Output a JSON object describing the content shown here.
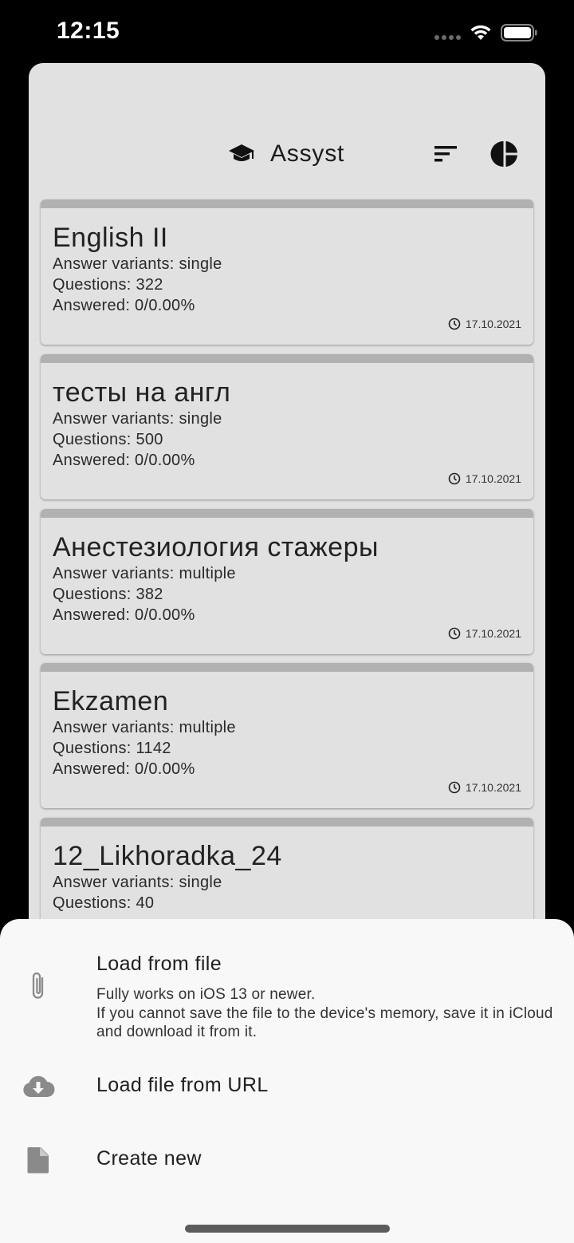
{
  "status_bar": {
    "time": "12:15"
  },
  "app": {
    "title": "Assyst",
    "icons": {
      "logo": "graduation-cap-icon",
      "sort": "sort-icon",
      "stats": "pie-chart-icon"
    }
  },
  "tests": [
    {
      "title": "English II",
      "variants": "Answer variants: single",
      "questions": "Questions: 322",
      "answered": "Answered: 0/0.00%",
      "date": "17.10.2021"
    },
    {
      "title": "тесты на англ",
      "variants": "Answer variants: single",
      "questions": "Questions: 500",
      "answered": "Answered: 0/0.00%",
      "date": "17.10.2021"
    },
    {
      "title": "Анестезиология стажеры",
      "variants": "Answer variants: multiple",
      "questions": "Questions: 382",
      "answered": "Answered: 0/0.00%",
      "date": "17.10.2021"
    },
    {
      "title": "Ekzamen",
      "variants": "Answer variants: multiple",
      "questions": "Questions: 1142",
      "answered": "Answered: 0/0.00%",
      "date": "17.10.2021"
    },
    {
      "title": "12_Likhoradka_24",
      "variants": "Answer variants: single",
      "questions": "Questions: 40"
    }
  ],
  "sheet": {
    "load_file": {
      "label": "Load from file",
      "note_1": "Fully works on iOS 13 or newer.",
      "note_2": "If you cannot save the file to the device's memory, save it in iCloud and download it from it."
    },
    "load_url": {
      "label": "Load file from URL"
    },
    "create_new": {
      "label": "Create new"
    }
  },
  "colors": {
    "background": "#000000",
    "sheet": "#e1e1e1",
    "card_stripe": "#b1b1b1",
    "bottom_sheet": "#f8f8f8",
    "icon_gray": "#8a8a8a"
  }
}
